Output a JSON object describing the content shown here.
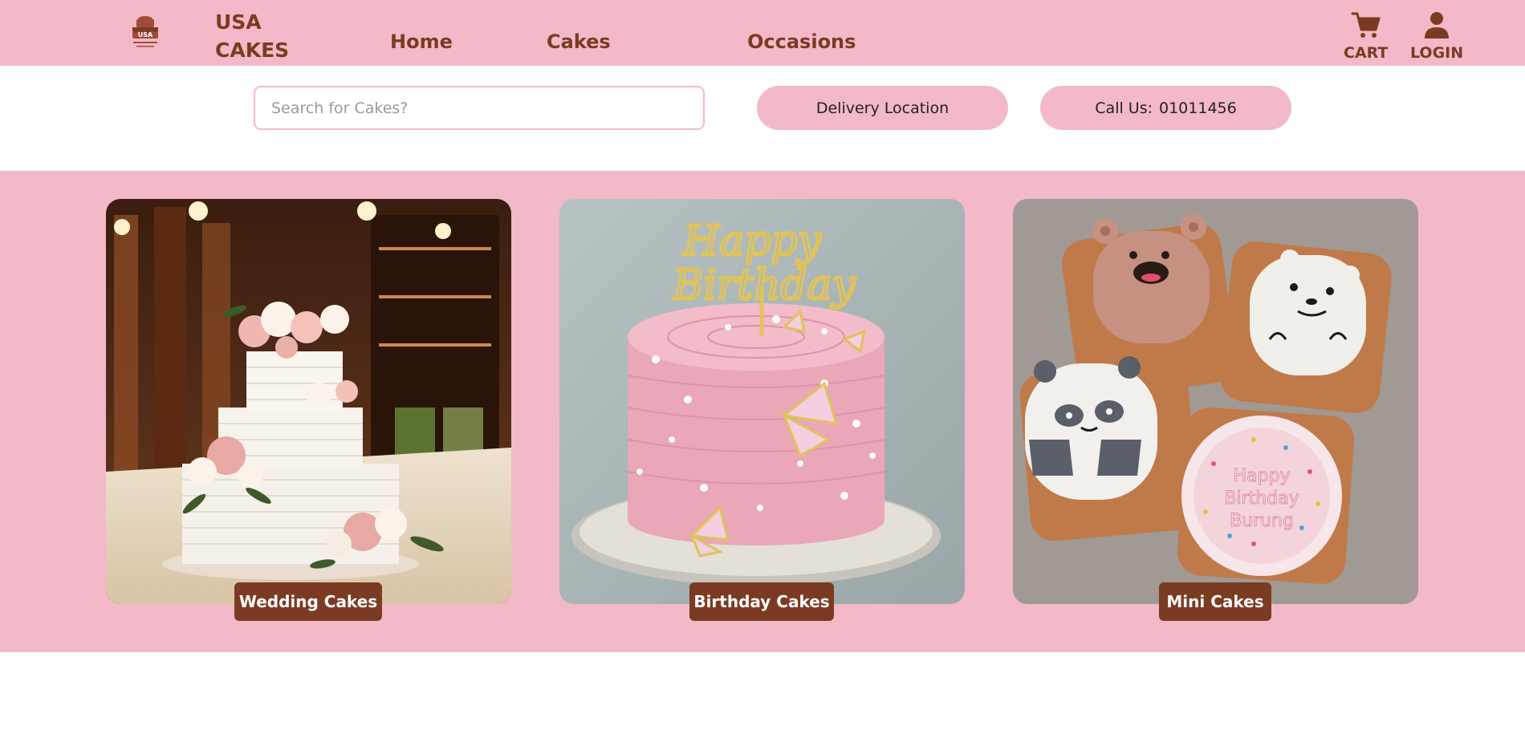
{
  "header": {
    "logo_text": "USA",
    "brand_line1": "USA",
    "brand_line2": "CAKES",
    "nav": {
      "home": "Home",
      "cakes": "Cakes",
      "occasions": "Occasions"
    },
    "cart_label": "CART",
    "login_label": "LOGIN"
  },
  "search": {
    "placeholder": "Search for Cakes?",
    "value": ""
  },
  "buttons": {
    "delivery_location": "Delivery Location",
    "call_label": "Call Us:",
    "call_number": "01011456"
  },
  "categories": [
    {
      "label": "Wedding Cakes"
    },
    {
      "label": "Birthday Cakes"
    },
    {
      "label": "Mini Cakes"
    }
  ],
  "colors": {
    "pink": "#f3b9c8",
    "brown": "#7b3b22"
  },
  "icons": {
    "cart": "cart-icon",
    "login": "user-icon"
  }
}
